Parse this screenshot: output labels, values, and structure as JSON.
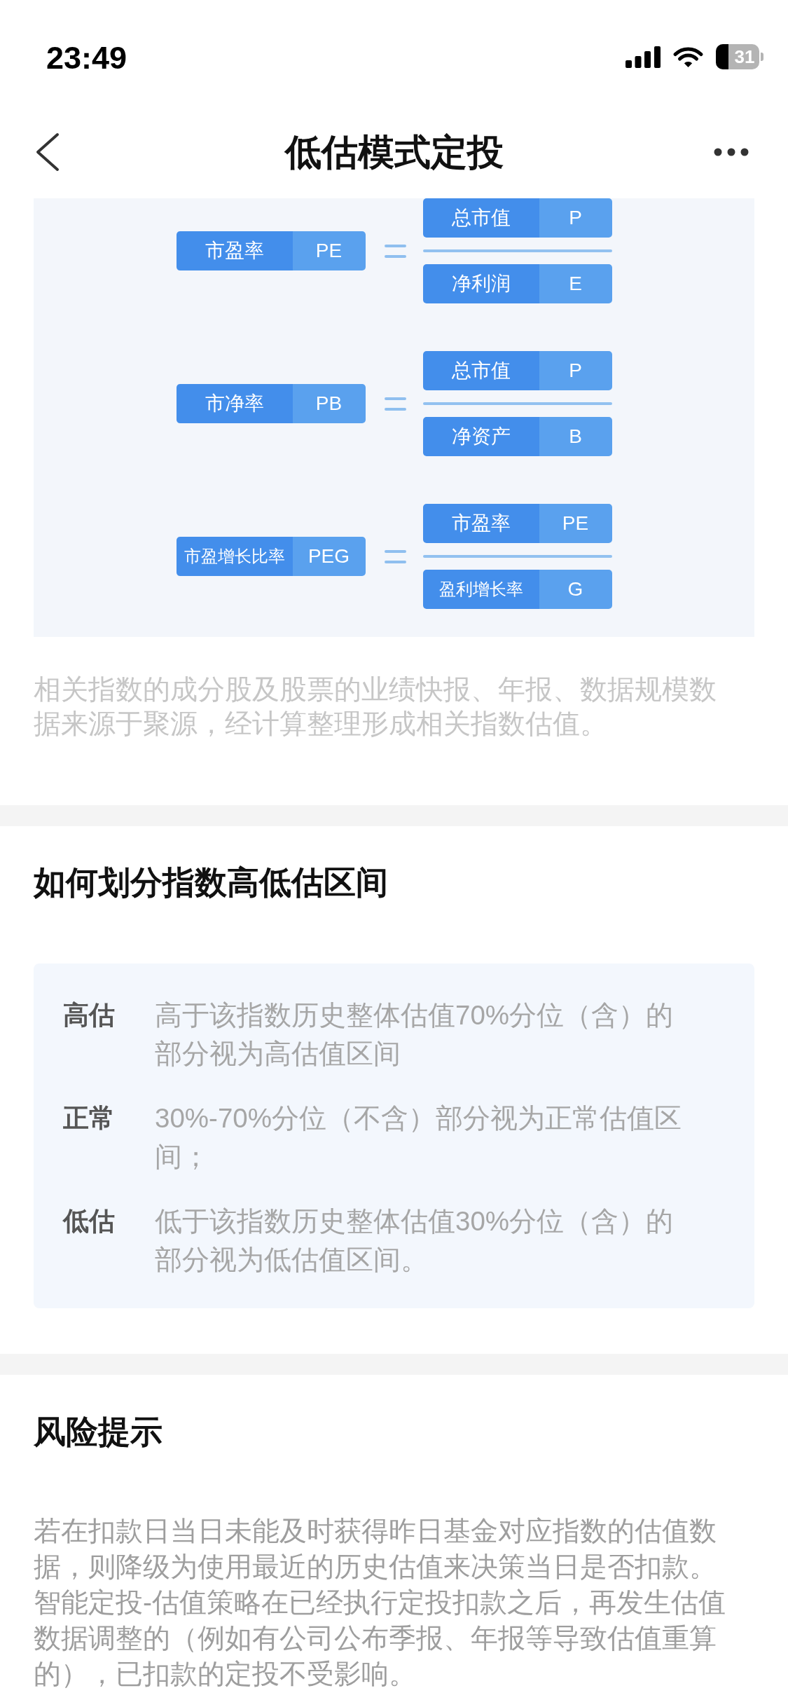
{
  "status_bar": {
    "time": "23:49",
    "battery": "31"
  },
  "nav": {
    "title": "低估模式定投"
  },
  "formula_panel": {
    "formulas": [
      {
        "left": {
          "name": "市盈率",
          "symbol": "PE"
        },
        "numerator": {
          "name": "总市值",
          "symbol": "P"
        },
        "denominator": {
          "name": "净利润",
          "symbol": "E"
        }
      },
      {
        "left": {
          "name": "市净率",
          "symbol": "PB"
        },
        "numerator": {
          "name": "总市值",
          "symbol": "P"
        },
        "denominator": {
          "name": "净资产",
          "symbol": "B"
        }
      },
      {
        "left": {
          "name": "市盈增长比率",
          "symbol": "PEG"
        },
        "numerator": {
          "name": "市盈率",
          "symbol": "PE"
        },
        "denominator": {
          "name": "盈利增长率",
          "symbol": "G"
        }
      }
    ]
  },
  "source_note": "相关指数的成分股及股票的业绩快报、年报、数据规模数据来源于聚源，经计算整理形成相关指数估值。",
  "valuation_ranges": {
    "title": "如何划分指数高低估区间",
    "rows": [
      {
        "label": "高估",
        "description": "高于该指数历史整体估值70%分位（含）的部分视为高估值区间"
      },
      {
        "label": "正常",
        "description": "30%-70%分位（不含）部分视为正常估值区间；"
      },
      {
        "label": "低估",
        "description": "低于该指数历史整体估值30%分位（含）的部分视为低估值区间。"
      }
    ]
  },
  "risk_notice": {
    "title": "风险提示",
    "text": "若在扣款日当日未能及时获得昨日基金对应指数的估值数据，则降级为使用最近的历史估值来决策当日是否扣款。智能定投-估值策略在已经执行定投扣款之后，再发生估值数据调整的（例如有公司公布季报、年报等导致估值重算的），已扣款的定投不受影响。"
  }
}
